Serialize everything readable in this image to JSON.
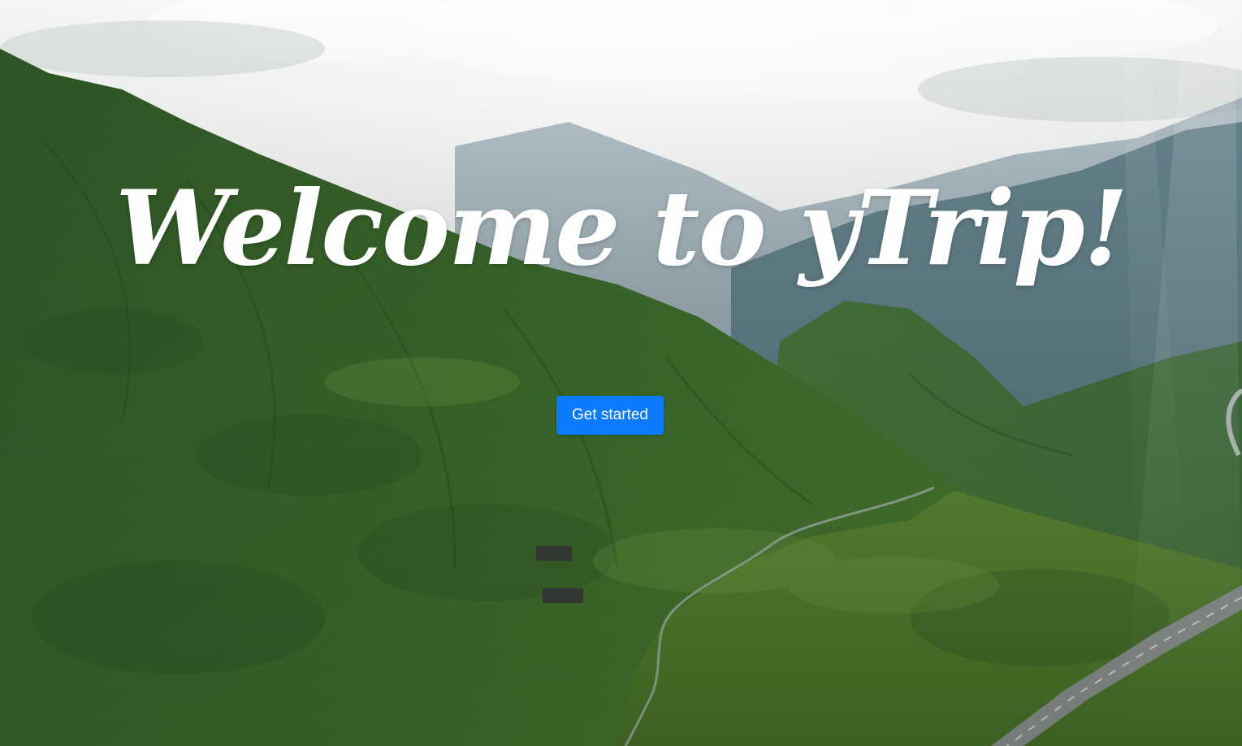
{
  "hero": {
    "title": "Welcome to yTrip!",
    "cta_label": "Get started"
  },
  "colors": {
    "button_bg": "#0d7bff",
    "button_text": "#ffffff",
    "title_text": "#ffffff",
    "sky": "#eef0ee",
    "mountain_far": "#5f7b8d",
    "mountain_green": "#3f6a2c",
    "valley_green": "#6b9b3a"
  }
}
